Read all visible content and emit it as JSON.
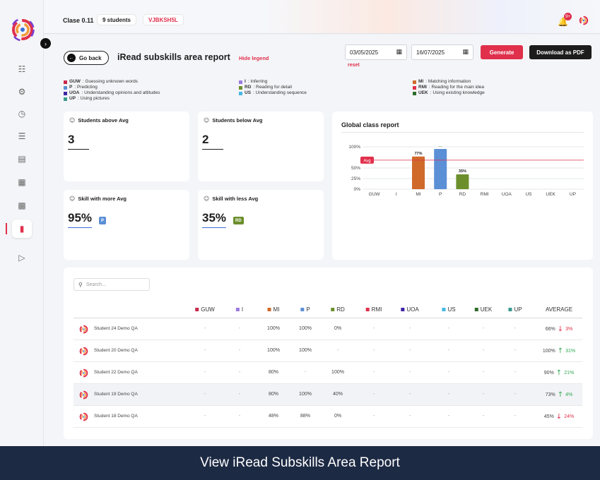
{
  "topbar": {
    "class_name": "Clase 0.11",
    "students_pill": "9 students",
    "class_code": "VJBKSH5L",
    "notification_count": "9+"
  },
  "header": {
    "back_label": "Go back",
    "title": "iRead subskills area report",
    "hide_legend": "Hide legend",
    "date_from": "03/05/2025",
    "date_to": "16/07/2025",
    "reset": "reset",
    "generate": "Generate",
    "download_pdf": "Download as PDF"
  },
  "legend": [
    {
      "code": "GUW",
      "desc": " : Guessing unknown words",
      "color": "#c8294c"
    },
    {
      "code": "P",
      "desc": " : Predicting",
      "color": "#5b8fd6"
    },
    {
      "code": "UOA",
      "desc": " : Understanding opinions and attitudes",
      "color": "#3f24a6"
    },
    {
      "code": "UP",
      "desc": " : Using pictures",
      "color": "#3a9a8e"
    },
    {
      "code": "I",
      "desc": " : Inferring",
      "color": "#9b7be0"
    },
    {
      "code": "RD",
      "desc": " : Reading for detail",
      "color": "#6c8f2c"
    },
    {
      "code": "US",
      "desc": " : Understanding sequence",
      "color": "#45b8e6"
    },
    {
      "code": "MI",
      "desc": " : Matching information",
      "color": "#d06a2a"
    },
    {
      "code": "RMI",
      "desc": " : Reading for the main idea",
      "color": "#e0304c"
    },
    {
      "code": "UEK",
      "desc": " : Using existing knowledge",
      "color": "#2f6b2a"
    }
  ],
  "cards": {
    "above": {
      "title": "Students above Avg",
      "value": "3"
    },
    "below": {
      "title": "Students below Avg",
      "value": "2"
    },
    "more": {
      "title": "Skill with more Avg",
      "value": "95%",
      "chip": "P",
      "chip_color": "#5b8fd6"
    },
    "less": {
      "title": "Skill with less Avg",
      "value": "35%",
      "chip": "RD",
      "chip_color": "#6c8f2c"
    }
  },
  "chart_title": "Global class report",
  "chart_data": {
    "type": "bar",
    "categories": [
      "GUW",
      "I",
      "MI",
      "P",
      "RD",
      "RMI",
      "UOA",
      "US",
      "UEK",
      "UP"
    ],
    "values": [
      0,
      0,
      77,
      95,
      35,
      0,
      0,
      0,
      0,
      0
    ],
    "data_labels": [
      "",
      "",
      "77%",
      "...",
      "35%",
      "",
      "",
      "",
      "",
      ""
    ],
    "colors": [
      "#c8294c",
      "#9b7be0",
      "#d06a2a",
      "#5b8fd6",
      "#6c8f2c",
      "#e0304c",
      "#3f24a6",
      "#45b8e6",
      "#2f6b2a",
      "#3a9a8e"
    ],
    "yticks": [
      "0%",
      "25%",
      "50%",
      "100%"
    ],
    "ytick_values": [
      0,
      25,
      50,
      100
    ],
    "ylim": [
      0,
      100
    ],
    "avg_value": 68.5,
    "avg_label": "Avg",
    "avg_color": "#e0304c",
    "grid": true
  },
  "table": {
    "search_placeholder": "Search...",
    "columns": [
      {
        "label": "GUW",
        "color": "#c8294c"
      },
      {
        "label": "I",
        "color": "#9b7be0"
      },
      {
        "label": "MI",
        "color": "#d06a2a"
      },
      {
        "label": "P",
        "color": "#5b8fd6"
      },
      {
        "label": "RD",
        "color": "#6c8f2c"
      },
      {
        "label": "RMI",
        "color": "#e0304c"
      },
      {
        "label": "UOA",
        "color": "#3f24a6"
      },
      {
        "label": "US",
        "color": "#45b8e6"
      },
      {
        "label": "UEK",
        "color": "#2f6b2a"
      },
      {
        "label": "UP",
        "color": "#3a9a8e"
      }
    ],
    "average_label": "AVERAGE",
    "rows": [
      {
        "name": "Student 24 Demo QA",
        "cells": [
          "-",
          "-",
          "100%",
          "100%",
          "0%",
          "-",
          "-",
          "-",
          "-",
          "-"
        ],
        "avg": "66%",
        "trend": "down",
        "delta": "3%"
      },
      {
        "name": "Student 20 Demo QA",
        "cells": [
          "-",
          "-",
          "100%",
          "100%",
          "-",
          "-",
          "-",
          "-",
          "-",
          "-"
        ],
        "avg": "100%",
        "trend": "up",
        "delta": "31%"
      },
      {
        "name": "Student 22 Demo QA",
        "cells": [
          "-",
          "-",
          "80%",
          "-",
          "100%",
          "-",
          "-",
          "-",
          "-",
          "-"
        ],
        "avg": "90%",
        "trend": "up",
        "delta": "21%"
      },
      {
        "name": "Student 19 Demo QA",
        "cells": [
          "-",
          "-",
          "80%",
          "100%",
          "40%",
          "-",
          "-",
          "-",
          "-",
          "-"
        ],
        "avg": "73%",
        "trend": "up",
        "delta": "4%"
      },
      {
        "name": "Student 18 Demo QA",
        "cells": [
          "-",
          "-",
          "48%",
          "88%",
          "0%",
          "-",
          "-",
          "-",
          "-",
          "-"
        ],
        "avg": "45%",
        "trend": "down",
        "delta": "24%"
      }
    ]
  },
  "footer": {
    "caption": "View iRead Subskills Area Report"
  }
}
